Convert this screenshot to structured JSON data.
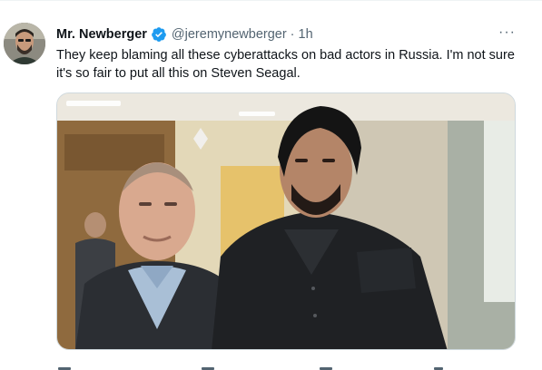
{
  "tweet": {
    "display_name": "Mr. Newberger",
    "handle": "@jeremynewberger",
    "separator": "·",
    "time": "1h",
    "more_label": "···",
    "text": "They keep blaming all these cyberattacks on bad actors in Russia. I'm not sure it's so fair to put all this on Steven Seagal.",
    "avatar_icon": "user-avatar",
    "verified_icon": "verified-badge-icon",
    "more_icon": "more-options-icon",
    "media_alt_icon": "photo-two-men"
  },
  "colors": {
    "text_primary": "#0f1419",
    "text_secondary": "#536471",
    "verified_blue": "#1d9bf0",
    "border": "#cfd9de"
  }
}
